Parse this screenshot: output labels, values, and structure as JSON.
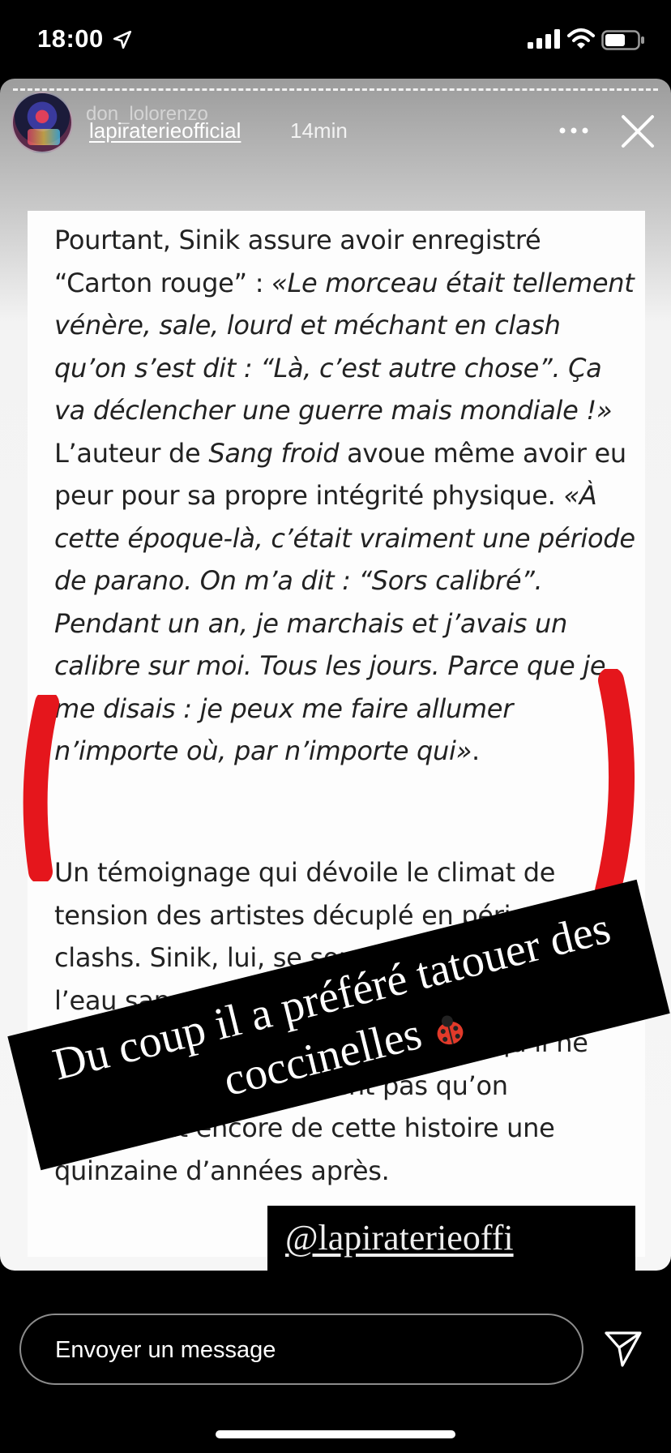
{
  "status_bar": {
    "time": "18:00",
    "icons": [
      "location-arrow-icon",
      "signal-icon",
      "wifi-icon",
      "battery-icon"
    ]
  },
  "story": {
    "ghost_username": "don_lolorenzo",
    "account_name": "lapiraterieofficial",
    "time_ago": "14min",
    "more_icon": "more-dots-icon",
    "close_icon": "close-icon"
  },
  "article": {
    "paragraph_1": {
      "t1": "Pourtant, Sinik assure avoir enregistré “Carton rouge” : ",
      "t2": "«Le morceau était tellement vénère, sale, lourd et méchant en clash qu’on s’est dit : “Là, c’est autre chose”. Ça va déclencher une guerre mais mondiale !»",
      "t3": " L’auteur de ",
      "t4": "Sang froid",
      "t5": " avoue même avoir eu peur pour sa propre intégrité physique. ",
      "t6": "«À cette époque-là, c’était vraiment une période de parano. On m’a dit : “Sors calibré”. Pendant un an, je marchais et j’avais un calibre sur moi. Tous les jours. Parce que je me disais : je peux me faire allumer n’importe où, par n’importe qui»",
      "t7": "."
    },
    "paragraph_2": "Un témoignage qui dévoile le climat de tension des artistes décuplé en période de clashs. Sinik, lui, se souvient s’être jeté à l’eau sans grande réflexion et avoir eu peur à l’époque. Mais il se doutait même qu’il ne s’imaginait certainement pas qu’on reparlerait encore de cette histoire une quinzaine d’années après."
  },
  "overlays": {
    "caption": "Du coup il a préféré tatouer des coccinelles",
    "caption_emoji": "ladybug-icon",
    "mention": "@lapiraterieoffi",
    "highlight_color": "#e5161c"
  },
  "footer": {
    "message_placeholder": "Envoyer un message",
    "send_icon": "send-icon"
  }
}
